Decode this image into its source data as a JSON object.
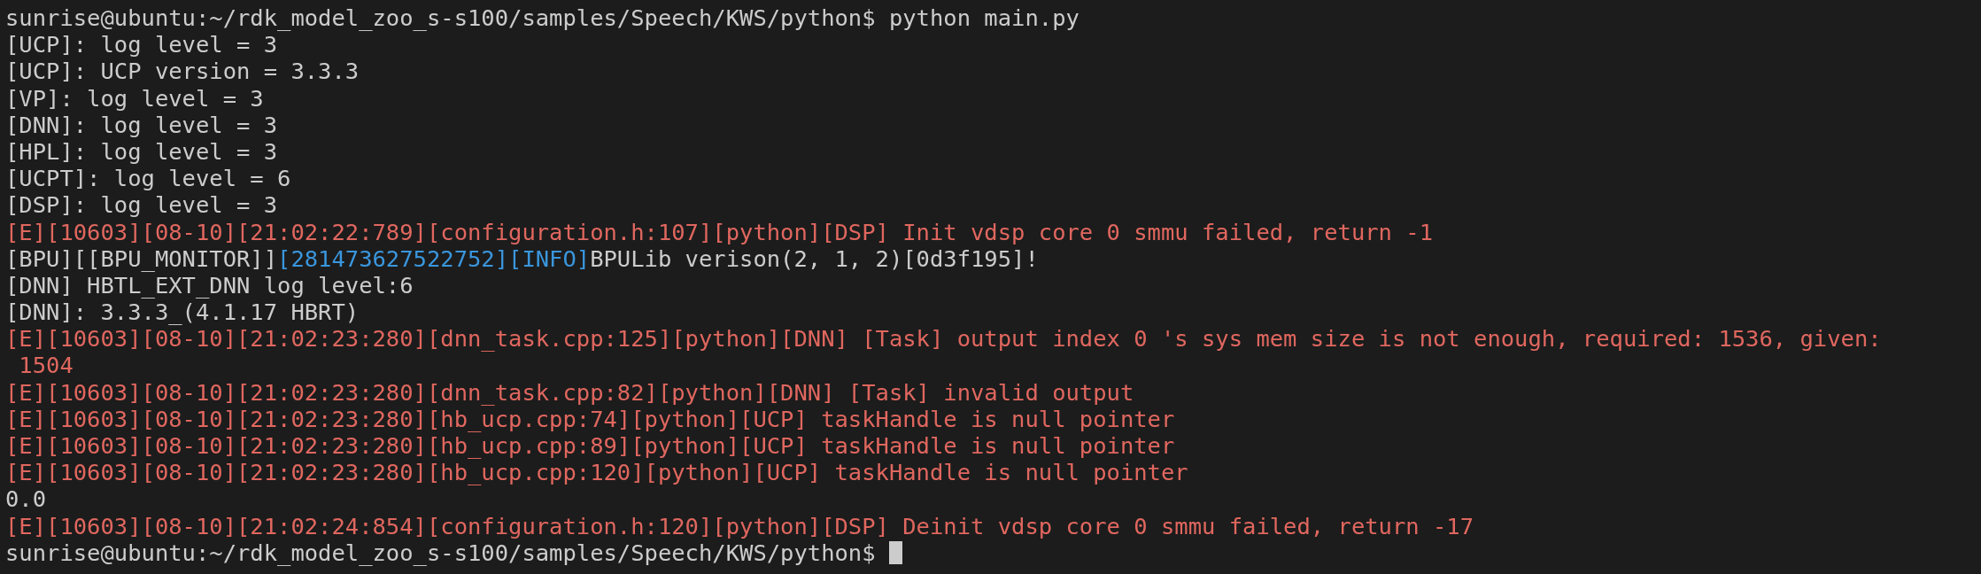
{
  "terminal": {
    "lines": [
      {
        "segments": [
          {
            "kind": "plain",
            "text": "sunrise@ubuntu:~/rdk_model_zoo_s-s100/samples/Speech/KWS/python$ python main.py"
          }
        ]
      },
      {
        "segments": [
          {
            "kind": "plain",
            "text": "[UCP]: log level = 3"
          }
        ]
      },
      {
        "segments": [
          {
            "kind": "plain",
            "text": "[UCP]: UCP version = 3.3.3"
          }
        ]
      },
      {
        "segments": [
          {
            "kind": "plain",
            "text": "[VP]: log level = 3"
          }
        ]
      },
      {
        "segments": [
          {
            "kind": "plain",
            "text": "[DNN]: log level = 3"
          }
        ]
      },
      {
        "segments": [
          {
            "kind": "plain",
            "text": "[HPL]: log level = 3"
          }
        ]
      },
      {
        "segments": [
          {
            "kind": "plain",
            "text": "[UCPT]: log level = 6"
          }
        ]
      },
      {
        "segments": [
          {
            "kind": "plain",
            "text": "[DSP]: log level = 3"
          }
        ]
      },
      {
        "segments": [
          {
            "kind": "error",
            "text": "[E][10603][08-10][21:02:22:789][configuration.h:107][python][DSP] Init vdsp core 0 smmu failed, return -1"
          }
        ]
      },
      {
        "segments": [
          {
            "kind": "plain",
            "text": "[BPU][[BPU_MONITOR]]"
          },
          {
            "kind": "info",
            "text": "[281473627522752][INFO]"
          },
          {
            "kind": "plain",
            "text": "BPULib verison(2, 1, 2)[0d3f195]!"
          }
        ]
      },
      {
        "segments": [
          {
            "kind": "plain",
            "text": "[DNN] HBTL_EXT_DNN log level:6"
          }
        ]
      },
      {
        "segments": [
          {
            "kind": "plain",
            "text": "[DNN]: 3.3.3_(4.1.17 HBRT)"
          }
        ]
      },
      {
        "segments": [
          {
            "kind": "error",
            "text": "[E][10603][08-10][21:02:23:280][dnn_task.cpp:125][python][DNN] [Task] output index 0 's sys mem size is not enough, required: 1536, given:"
          }
        ]
      },
      {
        "segments": [
          {
            "kind": "error",
            "text": " 1504"
          }
        ]
      },
      {
        "segments": [
          {
            "kind": "error",
            "text": "[E][10603][08-10][21:02:23:280][dnn_task.cpp:82][python][DNN] [Task] invalid output"
          }
        ]
      },
      {
        "segments": [
          {
            "kind": "error",
            "text": "[E][10603][08-10][21:02:23:280][hb_ucp.cpp:74][python][UCP] taskHandle is null pointer"
          }
        ]
      },
      {
        "segments": [
          {
            "kind": "error",
            "text": "[E][10603][08-10][21:02:23:280][hb_ucp.cpp:89][python][UCP] taskHandle is null pointer"
          }
        ]
      },
      {
        "segments": [
          {
            "kind": "error",
            "text": "[E][10603][08-10][21:02:23:280][hb_ucp.cpp:120][python][UCP] taskHandle is null pointer"
          }
        ]
      },
      {
        "segments": [
          {
            "kind": "plain",
            "text": "0.0"
          }
        ]
      },
      {
        "segments": [
          {
            "kind": "error",
            "text": "[E][10603][08-10][21:02:24:854][configuration.h:120][python][DSP] Deinit vdsp core 0 smmu failed, return -17"
          }
        ]
      },
      {
        "cursor": true,
        "segments": [
          {
            "kind": "plain",
            "text": "sunrise@ubuntu:~/rdk_model_zoo_s-s100/samples/Speech/KWS/python$ "
          }
        ]
      }
    ]
  }
}
